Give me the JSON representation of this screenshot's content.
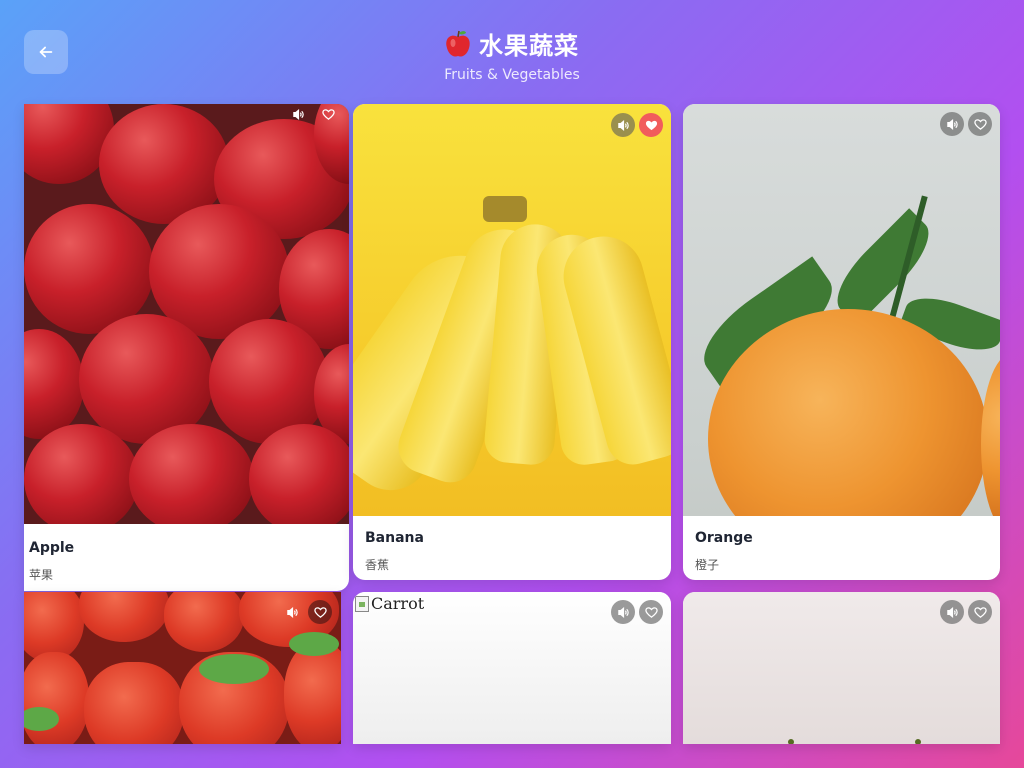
{
  "header": {
    "title": "水果蔬菜",
    "subtitle": "Fruits & Vegetables",
    "emoji_icon": "apple-emoji-icon"
  },
  "back_button": {
    "icon": "arrow-left-icon"
  },
  "cards": [
    {
      "name": "Apple",
      "name_zh": "苹果",
      "favorited": false
    },
    {
      "name": "Banana",
      "name_zh": "香蕉",
      "favorited": true
    },
    {
      "name": "Orange",
      "name_zh": "橙子",
      "favorited": false
    },
    {
      "name": "",
      "name_zh": "",
      "favorited": false
    },
    {
      "name": "",
      "name_zh": "",
      "favorited": false,
      "image_alt": "Carrot"
    },
    {
      "name": "",
      "name_zh": "",
      "favorited": false
    }
  ],
  "colors": {
    "favorite_active": "#f15c5c",
    "icon_button_bg": "rgba(90,90,90,0.6)"
  }
}
